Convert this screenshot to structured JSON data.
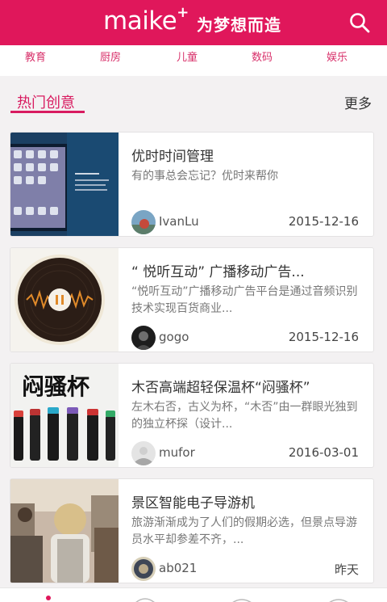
{
  "header": {
    "logo_text": "maike",
    "logo_plus": "+",
    "slogan": "为梦想而造"
  },
  "categories": [
    "教育",
    "厨房",
    "儿童",
    "数码",
    "娱乐"
  ],
  "section": {
    "title": "热门创意",
    "more_label": "更多"
  },
  "cards": [
    {
      "title": "优时时间管理",
      "desc": "有的事总会忘记？优时来帮你",
      "author": "IvanLu",
      "date": "2015-12-16"
    },
    {
      "title": "“ 悦听互动” 广播移动广告...",
      "desc": "“悦听互动”广播移动广告平台是通过音频识别技术实现百货商业...",
      "author": "gogo",
      "date": "2015-12-16"
    },
    {
      "title": "木否高端超轻保温杯“闷骚杯”",
      "desc": "左木右否，古义为杯，“木否”由一群眼光独到的独立杯探（设计...",
      "author": "mufor",
      "date": "2016-03-01",
      "thumb_text": "闷骚杯"
    },
    {
      "title": "景区智能电子导游机",
      "desc": "旅游渐渐成为了人们的假期必选，但景点导游员水平却参差不齐，...",
      "author": "ab021",
      "date": "昨天"
    }
  ],
  "colors": {
    "brand": "#e0175b",
    "accent_text": "#d81b60"
  }
}
